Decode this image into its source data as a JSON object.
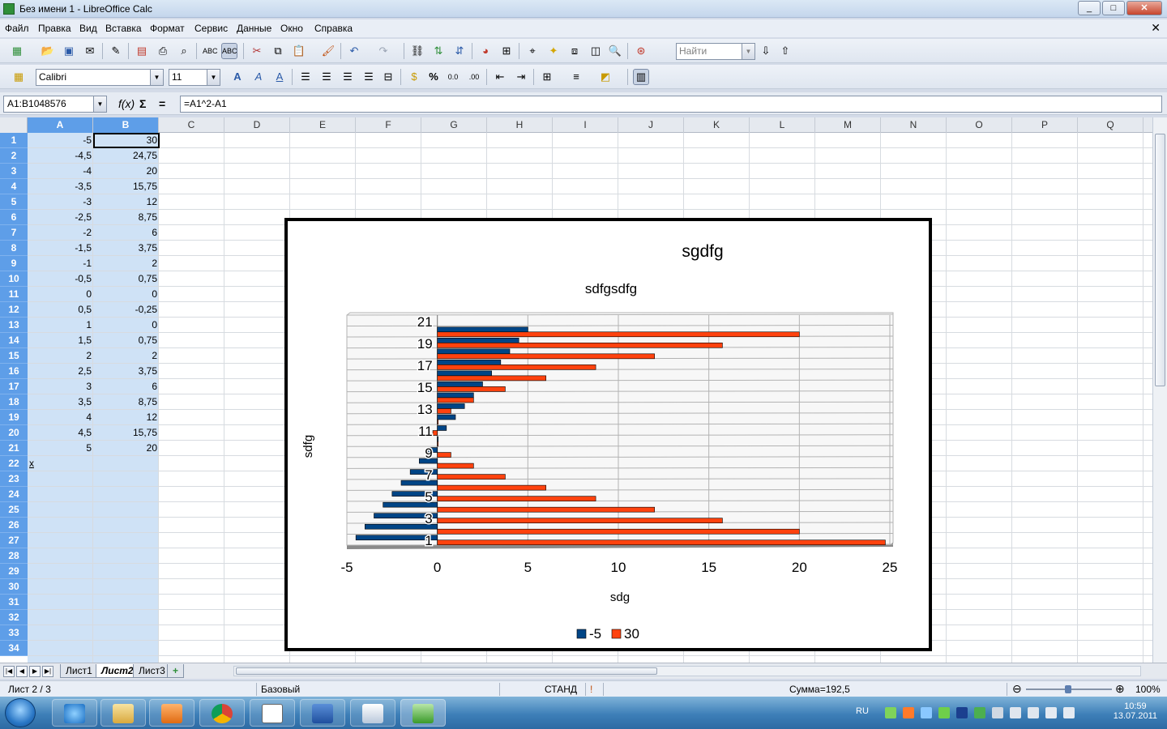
{
  "window": {
    "title": "Без имени 1 - LibreOffice Calc",
    "min": "_",
    "max": "□",
    "close": "✕"
  },
  "menu": [
    "Файл",
    "Правка",
    "Вид",
    "Вставка",
    "Формат",
    "Сервис",
    "Данные",
    "Окно",
    "Справка"
  ],
  "toolbar": {
    "find_placeholder": "Найти",
    "font_name": "Calibri",
    "font_size": "11"
  },
  "formula_bar": {
    "name_box": "A1:B1048576",
    "formula": "=A1^2-A1"
  },
  "columns": [
    "A",
    "B",
    "C",
    "D",
    "E",
    "F",
    "G",
    "H",
    "I",
    "J",
    "K",
    "L",
    "M",
    "N",
    "O",
    "P",
    "Q"
  ],
  "rows": [
    "1",
    "2",
    "3",
    "4",
    "5",
    "6",
    "7",
    "8",
    "9",
    "10",
    "11",
    "12",
    "13",
    "14",
    "15",
    "16",
    "17",
    "18",
    "19",
    "20",
    "21",
    "22",
    "23",
    "24",
    "25",
    "26",
    "27",
    "28",
    "29",
    "30",
    "31",
    "32",
    "33",
    "34"
  ],
  "cells": {
    "A": [
      "-5",
      "-4,5",
      "-4",
      "-3,5",
      "-3",
      "-2,5",
      "-2",
      "-1,5",
      "-1",
      "-0,5",
      "0",
      "0,5",
      "1",
      "1,5",
      "2",
      "2,5",
      "3",
      "3,5",
      "4",
      "4,5",
      "5"
    ],
    "B": [
      "30",
      "24,75",
      "20",
      "15,75",
      "12",
      "8,75",
      "6",
      "3,75",
      "2",
      "0,75",
      "0",
      "-0,25",
      "0",
      "0,75",
      "2",
      "3,75",
      "6",
      "8,75",
      "12",
      "15,75",
      "20"
    ],
    "A22": "x"
  },
  "chart_data": {
    "type": "bar",
    "orientation": "horizontal",
    "title": "sgdfg",
    "subtitle": "sdfgsdfg",
    "xlabel": "sdg",
    "ylabel": "sdfg",
    "xlim": [
      -5,
      25
    ],
    "x_ticks": [
      "-5",
      "0",
      "5",
      "10",
      "15",
      "20",
      "25"
    ],
    "categories": [
      "1",
      "2",
      "3",
      "4",
      "5",
      "6",
      "7",
      "8",
      "9",
      "10",
      "11",
      "12",
      "13",
      "14",
      "15",
      "16",
      "17",
      "18",
      "19",
      "20",
      "21"
    ],
    "category_ticks": [
      "1",
      "3",
      "5",
      "7",
      "9",
      "11",
      "13",
      "15",
      "17",
      "19",
      "21"
    ],
    "series": [
      {
        "name": "-5",
        "color": "#004586",
        "values": [
          -4.5,
          -4,
          -3.5,
          -3,
          -2.5,
          -2,
          -1.5,
          -1,
          -0.5,
          0,
          0.5,
          1,
          1.5,
          2,
          2.5,
          3,
          3.5,
          4,
          4.5,
          5,
          null
        ]
      },
      {
        "name": "30",
        "color": "#ff420e",
        "values": [
          24.75,
          20,
          15.75,
          12,
          8.75,
          6,
          3.75,
          2,
          0.75,
          0,
          -0.25,
          0,
          0.75,
          2,
          3.75,
          6,
          8.75,
          12,
          15.75,
          20,
          null
        ]
      }
    ],
    "legend_position": "bottom",
    "grid": true
  },
  "sheets": {
    "tabs": [
      "Лист1",
      "Лист2",
      "Лист3"
    ],
    "active": "Лист2",
    "add": "+"
  },
  "status": {
    "sheet": "Лист 2 / 3",
    "style": "Базовый",
    "mode": "СТАНД",
    "sum": "Сумма=192,5",
    "zoom": "100%",
    "zoom_minus": "⊖",
    "zoom_plus": "⊕"
  },
  "taskbar": {
    "lang": "RU",
    "time": "10:59",
    "date": "13.07.2011"
  }
}
